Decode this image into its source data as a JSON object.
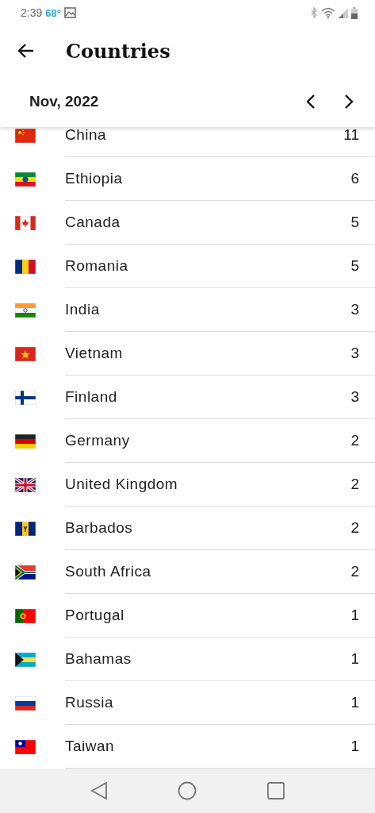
{
  "status_bar": {
    "time": "2:39",
    "temperature": "68°"
  },
  "header": {
    "title": "Countries"
  },
  "period": {
    "label": "Nov, 2022"
  },
  "countries": [
    {
      "name": "China",
      "count": "11",
      "kind": "cn"
    },
    {
      "name": "Ethiopia",
      "count": "6",
      "kind": "et"
    },
    {
      "name": "Canada",
      "count": "5",
      "kind": "ca"
    },
    {
      "name": "Romania",
      "count": "5",
      "kind": "ro"
    },
    {
      "name": "India",
      "count": "3",
      "kind": "in"
    },
    {
      "name": "Vietnam",
      "count": "3",
      "kind": "vn"
    },
    {
      "name": "Finland",
      "count": "3",
      "kind": "fi"
    },
    {
      "name": "Germany",
      "count": "2",
      "kind": "de"
    },
    {
      "name": "United Kingdom",
      "count": "2",
      "kind": "gb"
    },
    {
      "name": "Barbados",
      "count": "2",
      "kind": "bb"
    },
    {
      "name": "South Africa",
      "count": "2",
      "kind": "za"
    },
    {
      "name": "Portugal",
      "count": "1",
      "kind": "pt"
    },
    {
      "name": "Bahamas",
      "count": "1",
      "kind": "bs"
    },
    {
      "name": "Russia",
      "count": "1",
      "kind": "ru"
    },
    {
      "name": "Taiwan",
      "count": "1",
      "kind": "tw"
    }
  ]
}
